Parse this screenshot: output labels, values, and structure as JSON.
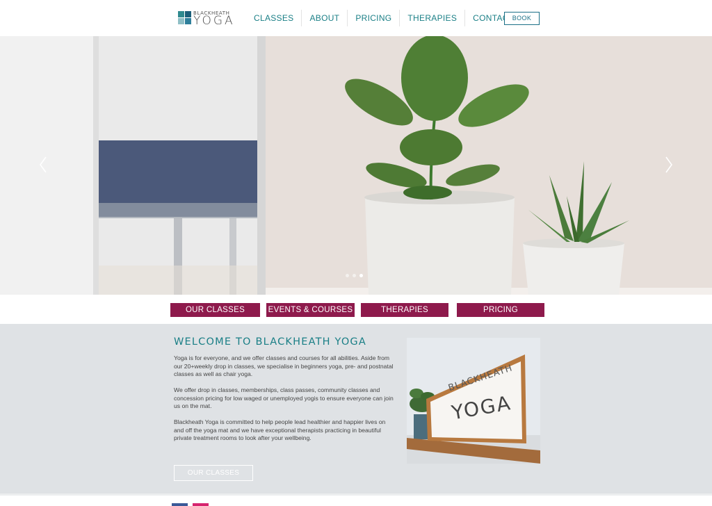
{
  "header": {
    "logo": {
      "small": "BLACKHEATH",
      "big": "YOGA"
    },
    "nav": [
      "CLASSES",
      "ABOUT",
      "PRICING",
      "THERAPIES",
      "CONTACT"
    ],
    "book_label": "BOOK"
  },
  "hero": {
    "slides_count": 3,
    "active_slide": 3,
    "prev_icon": "chevron-left-icon",
    "next_icon": "chevron-right-icon"
  },
  "buttons": [
    "OUR CLASSES",
    "EVENTS & COURSES",
    "THERAPIES",
    "PRICING"
  ],
  "welcome": {
    "title": "WELCOME TO BLACKHEATH YOGA",
    "paragraphs": [
      "Yoga is for everyone, and we offer classes and courses for all abilities. Aside from our 20+weekly drop in classes, we specialise in beginners yoga, pre- and postnatal classes as well as chair yoga.",
      "We offer drop in classes, memberships, class passes, community classes and concession pricing for low waged or unemployed yogis to ensure everyone can join us on the mat.",
      "Blackheath Yoga is committed to help people lead healthier and happier lives on and off the yoga mat and we have exceptional therapists practicing in beautiful private treatment rooms to look after your wellbeing."
    ],
    "button_label": "OUR CLASSES",
    "photo_sign": {
      "line1": "BLACKHEATH",
      "line2": "YOGA"
    }
  },
  "footer": {
    "icons": [
      "facebook-icon",
      "instagram-icon"
    ]
  },
  "colors": {
    "teal": "#1a7f86",
    "plum": "#8e1a4c",
    "section_bg": "#dfe2e5"
  }
}
